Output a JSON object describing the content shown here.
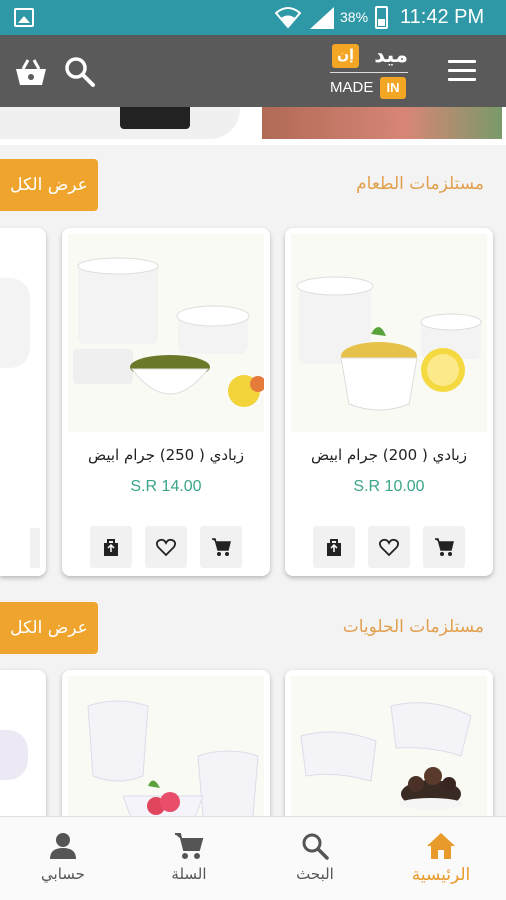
{
  "status_bar": {
    "battery": "38%",
    "time": "11:42 PM"
  },
  "app_bar": {
    "logo_arabic": "ميد",
    "logo_arabic_box": "إن",
    "logo_english": "MADE",
    "logo_english_box": "IN",
    "icons": [
      "cart-icon",
      "search-icon",
      "menu-icon"
    ]
  },
  "sections": [
    {
      "title": "مستلزمات الطعام",
      "view_all_label": "عرض الكل",
      "products": [
        {
          "name": "زبادي ( 200) جرام ابيض",
          "price": "S.R 10.00"
        },
        {
          "name": "زبادي ( 250) جرام ابيض",
          "price": "S.R 14.00"
        }
      ]
    },
    {
      "title": "مستلزمات الحلويات",
      "view_all_label": "عرض الكل"
    }
  ],
  "bottom_nav": {
    "items": [
      {
        "label": "الرئيسية",
        "icon": "home-icon",
        "active": true
      },
      {
        "label": "البحث",
        "icon": "search-icon",
        "active": false
      },
      {
        "label": "السلة",
        "icon": "cart-icon",
        "active": false
      },
      {
        "label": "حسابي",
        "icon": "account-icon",
        "active": false
      }
    ]
  },
  "colors": {
    "status_bar": "#2f98a6",
    "app_bar": "#5a5a5a",
    "accent": "#efa52d",
    "price": "#3aa58a",
    "section_title": "#e2a04e"
  }
}
